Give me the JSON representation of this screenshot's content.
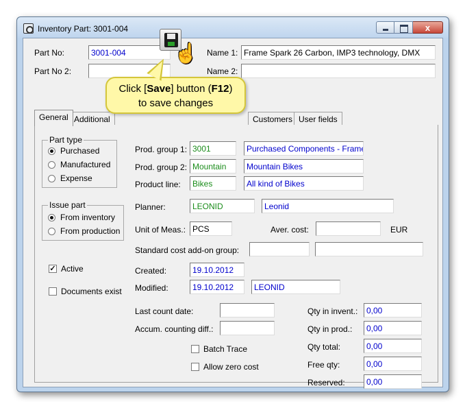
{
  "window": {
    "title": "Inventory Part: 3001-004",
    "close_glyph": "x"
  },
  "header": {
    "part_no_label": "Part No:",
    "part_no_value": "3001-004",
    "part_no2_label": "Part No 2:",
    "part_no2_value": "",
    "name1_label": "Name 1:",
    "name1_value": "Frame Spark 26 Carbon, IMP3 technology, DMX",
    "name2_label": "Name 2:",
    "name2_value": ""
  },
  "tabs": [
    {
      "label": "General"
    },
    {
      "label": "Additional"
    },
    {
      "label": "Customers"
    },
    {
      "label": "User fields"
    }
  ],
  "tooltip": {
    "line1_pre": "Click [",
    "line1_bold": "Save",
    "line1_mid": "] button (",
    "line1_key": "F12",
    "line1_post": ")",
    "line2": "to save changes"
  },
  "general": {
    "part_type": {
      "title": "Part type",
      "options": [
        "Purchased",
        "Manufactured",
        "Expense"
      ],
      "selected": "Purchased"
    },
    "issue_part": {
      "title": "Issue part",
      "options": [
        "From inventory",
        "From production"
      ],
      "selected": "From inventory"
    },
    "active_label": "Active",
    "active_checked": true,
    "active_mark": "✓",
    "documents_exist_label": "Documents exist",
    "documents_exist_checked": false,
    "prod_group1_label": "Prod. group 1:",
    "prod_group1_code": "3001",
    "prod_group1_name": "Purchased Components - Frames",
    "prod_group2_label": "Prod. group 2:",
    "prod_group2_code": "Mountain",
    "prod_group2_name": "Mountain Bikes",
    "product_line_label": "Product line:",
    "product_line_code": "Bikes",
    "product_line_name": "All kind of Bikes",
    "planner_label": "Planner:",
    "planner_code": "LEONID",
    "planner_name": "Leonid",
    "unit_label": "Unit of Meas.:",
    "unit_value": "PCS",
    "aver_cost_label": "Aver. cost:",
    "aver_cost_value": "",
    "currency": "EUR",
    "std_cost_label": "Standard cost add-on group:",
    "std_cost_code": "",
    "std_cost_name": "",
    "created_label": "Created:",
    "created_value": "19.10.2012",
    "modified_label": "Modified:",
    "modified_value": "19.10.2012",
    "modified_by": "LEONID",
    "last_count_label": "Last count date:",
    "last_count_value": "",
    "accum_label": "Accum. counting diff.:",
    "accum_value": "",
    "batch_trace_label": "Batch Trace",
    "allow_zero_label": "Allow zero cost",
    "qty": [
      {
        "label": "Qty in invent.:",
        "value": "0,00"
      },
      {
        "label": "Qty in prod.:",
        "value": "0,00"
      },
      {
        "label": "Qty total:",
        "value": "0,00"
      },
      {
        "label": "Free qty:",
        "value": "0,00"
      },
      {
        "label": "Reserved:",
        "value": "0,00"
      }
    ]
  },
  "colors": {
    "link_blue": "#0000cc",
    "code_green": "#1a8c1a",
    "tooltip_bg": "#fff8a8"
  }
}
